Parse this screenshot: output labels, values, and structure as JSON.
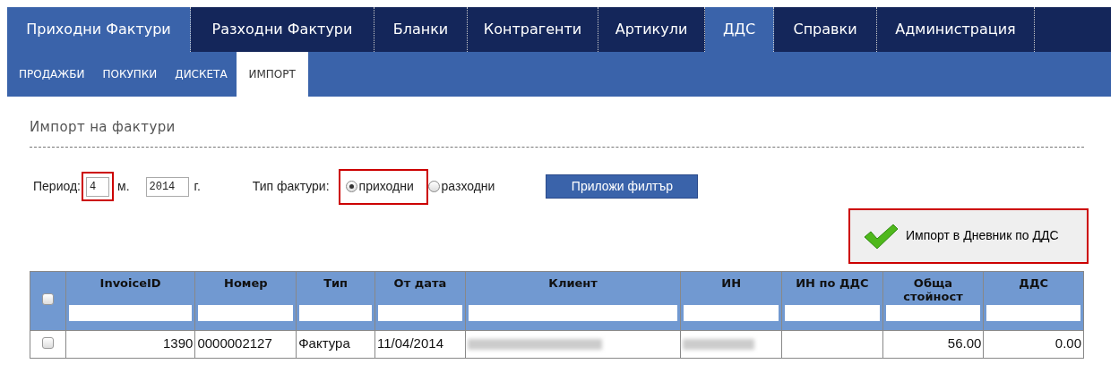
{
  "main_tabs": [
    {
      "label": "Приходни Фактури",
      "selected": true
    },
    {
      "label": "Разходни Фактури",
      "selected": false
    },
    {
      "label": "Бланки",
      "selected": false
    },
    {
      "label": "Контрагенти",
      "selected": false
    },
    {
      "label": "Артикули",
      "selected": false
    },
    {
      "label": "ДДС",
      "selected": true
    },
    {
      "label": "Справки",
      "selected": false
    },
    {
      "label": "Администрация",
      "selected": false
    }
  ],
  "sub_tabs": [
    {
      "label": "ПРОДАЖБИ",
      "selected": false
    },
    {
      "label": "ПОКУПКИ",
      "selected": false
    },
    {
      "label": "ДИСКЕТА",
      "selected": false
    },
    {
      "label": "ИМПОРТ",
      "selected": true
    }
  ],
  "page_title": "Импорт на фактури",
  "filter": {
    "period_label": "Период:",
    "month": {
      "value": "4",
      "highlighted": true
    },
    "month_suffix": "м.",
    "year": {
      "value": "2014"
    },
    "year_suffix": "г.",
    "type_label": "Тип фактури:",
    "type_options": [
      {
        "label": "приходни",
        "selected": true
      },
      {
        "label": "разходни",
        "selected": false
      }
    ],
    "type_highlighted": true,
    "apply_button": "Приложи филтър"
  },
  "import_button": {
    "label": "Импорт в Дневник по ДДС",
    "highlighted": true
  },
  "table": {
    "select_all_checked": false,
    "columns": [
      "InvoiceID",
      "Номер",
      "Тип",
      "От дата",
      "Клиент",
      "ИН",
      "ИН по ДДС",
      "Обща стойност",
      "ДДС"
    ],
    "rows": [
      {
        "checked": false,
        "cells": [
          {
            "kind": "number",
            "text": "1390"
          },
          {
            "kind": "text",
            "text": "0000002127"
          },
          {
            "kind": "text",
            "text": "Фактура"
          },
          {
            "kind": "text",
            "text": "11/04/2014"
          },
          {
            "kind": "blurred"
          },
          {
            "kind": "blurred"
          },
          {
            "kind": "empty"
          },
          {
            "kind": "number",
            "text": "56.00"
          },
          {
            "kind": "number",
            "text": "0.00"
          }
        ]
      }
    ]
  }
}
